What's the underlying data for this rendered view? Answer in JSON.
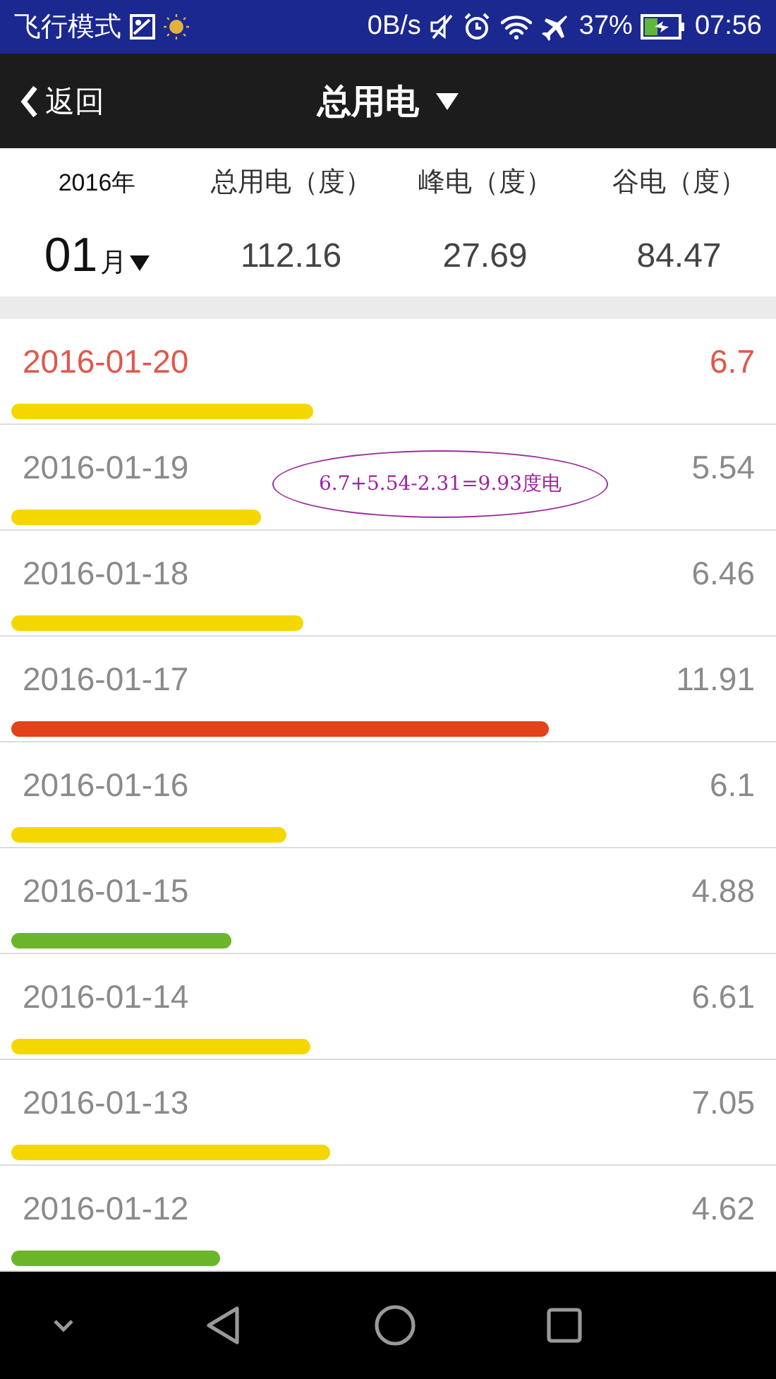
{
  "status_bar": {
    "mode": "飞行模式",
    "speed": "0B/s",
    "battery": "37%",
    "time": "07:56"
  },
  "header": {
    "back": "返回",
    "title": "总用电"
  },
  "summary": {
    "year": "2016年",
    "month": "01",
    "month_unit": "月",
    "columns": [
      {
        "label": "总用电（度）",
        "value": "112.16"
      },
      {
        "label": "峰电（度）",
        "value": "27.69"
      },
      {
        "label": "谷电（度）",
        "value": "84.47"
      }
    ]
  },
  "days": [
    {
      "date": "2016-01-20",
      "value": "6.7",
      "selected": true,
      "color": "#f5d700"
    },
    {
      "date": "2016-01-19",
      "value": "5.54",
      "selected": false,
      "color": "#f5d700"
    },
    {
      "date": "2016-01-18",
      "value": "6.46",
      "selected": false,
      "color": "#f5d700"
    },
    {
      "date": "2016-01-17",
      "value": "11.91",
      "selected": false,
      "color": "#e4421a"
    },
    {
      "date": "2016-01-16",
      "value": "6.1",
      "selected": false,
      "color": "#f5d700"
    },
    {
      "date": "2016-01-15",
      "value": "4.88",
      "selected": false,
      "color": "#6bb52a"
    },
    {
      "date": "2016-01-14",
      "value": "6.61",
      "selected": false,
      "color": "#f5d700"
    },
    {
      "date": "2016-01-13",
      "value": "7.05",
      "selected": false,
      "color": "#f5d700"
    },
    {
      "date": "2016-01-12",
      "value": "4.62",
      "selected": false,
      "color": "#6bb52a"
    }
  ],
  "annotation": {
    "text": "6.7+5.54-2.31=9.93度电"
  }
}
